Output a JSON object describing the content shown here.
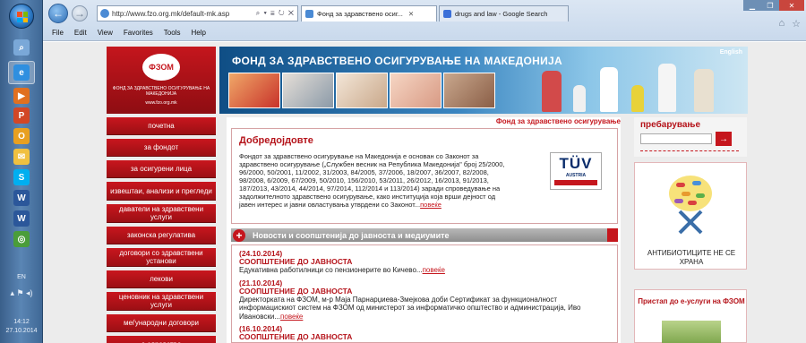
{
  "taskbar": {
    "apps": [
      {
        "name": "search-icon",
        "color": "#7aa8d8",
        "glyph": "⌕",
        "active": false
      },
      {
        "name": "internet-explorer-icon",
        "color": "#2f8fe0",
        "glyph": "e",
        "active": true
      },
      {
        "name": "media-player-icon",
        "color": "#e07020",
        "glyph": "▶",
        "active": false
      },
      {
        "name": "powerpoint-icon",
        "color": "#d24726",
        "glyph": "P",
        "active": false
      },
      {
        "name": "outlook-icon",
        "color": "#e8a020",
        "glyph": "O",
        "active": false
      },
      {
        "name": "mail-icon",
        "color": "#f0c040",
        "glyph": "✉",
        "active": false
      },
      {
        "name": "skype-icon",
        "color": "#00aff0",
        "glyph": "S",
        "active": false
      },
      {
        "name": "word-icon",
        "color": "#2b579a",
        "glyph": "W",
        "active": false
      },
      {
        "name": "word-icon-2",
        "color": "#2b579a",
        "glyph": "W",
        "active": false
      },
      {
        "name": "chrome-icon",
        "color": "#4a9d3a",
        "glyph": "◎",
        "active": false
      }
    ],
    "language": "EN",
    "time": "14:12",
    "date": "27.10.2014"
  },
  "browser": {
    "url": "http://www.fzo.org.mk/default-mk.asp",
    "address_actions": "⌕ ▾ ≣ ↻ ✕",
    "tabs": [
      {
        "label": "Фонд за здравствено осиг...",
        "active": true,
        "color": "#4a8ad4"
      },
      {
        "label": "drugs and law - Google Search",
        "active": false,
        "color": "#3a6fd8"
      }
    ],
    "menu": [
      "File",
      "Edit",
      "View",
      "Favorites",
      "Tools",
      "Help"
    ]
  },
  "site": {
    "logo_text": "ФЗОМ",
    "logo_sub": "ФОНД ЗА ЗДРАВСТВЕНО ОСИГУРУВАЊЕ НА МАКЕДОНИЈА",
    "logo_url": "www.fzo.org.mk",
    "banner_title": "ФОНД ЗА ЗДРАВСТВЕНО ОСИГУРУВАЊЕ НА МАКЕДОНИЈА",
    "english_link": "English",
    "nav": [
      "почетна",
      "за фондот",
      "за осигурени лица",
      "извештаи, анализи и прегледи",
      "даватели на здравствени услуги",
      "законска регулатива",
      "договори со здравствени установи",
      "лекови",
      "ценовник на здравствени услуги",
      "меѓународни договори",
      "е-здравство"
    ],
    "marquee": "Фонд за здравствено осигурување",
    "welcome": {
      "title": "Добредојдовте",
      "text": "Фондот за здравствено осигурување на Македонија е основан со Законот за здравствено осигурување („Службен весник на Република Македонија\" број 25/2000, 96/2000, 50/2001, 11/2002, 31/2003, 84/2005, 37/2006, 18/2007, 36/2007, 82/2008, 98/2008, 6/2009, 67/2009, 50/2010, 156/2010, 53/2011, 26/2012, 16/2013, 91/2013, 187/2013, 43/2014, 44/2014, 97/2014, 112/2014 и 113/2014) заради спроведување на задолжителното здравствено осигурување, како институција која врши дејност од јавен интерес и јавни овластувања утврдени со Законот...",
      "more": "повеќе"
    },
    "tuv": {
      "big": "TÜV",
      "sub": "AUSTRIA"
    },
    "news_title": "Новости и соопштенија до јавноста и медиумите",
    "news": [
      {
        "date": "(24.10.2014)",
        "category": "СООПШТЕНИЕ ДО ЈАВНОСТА",
        "text": "Едукативна работилници со пензионерите во Кичево...",
        "more": "повеќе"
      },
      {
        "date": "(21.10.2014)",
        "category": "СООПШТЕНИЕ ДО ЈАВНОСТА",
        "text": "Директорката на ФЗОМ, м-р Маја Парнарџиева-Змејкова доби Сертификат за функционалност информацискиот систем на ФЗОМ од министерот за информатичко општество и администрација, Иво Ивановски...",
        "more": "повеќе"
      },
      {
        "date": "(16.10.2014)",
        "category": "СООПШТЕНИЕ ДО ЈАВНОСТА",
        "text": "",
        "more": ""
      }
    ],
    "search_label": "пребарување",
    "search_value": "",
    "search_go": "→",
    "antibiotic_text": "АНТИБИОТИЦИТЕ НЕ СЕ ХРАНА",
    "eservice_text": "Пристап до е-услуги на ФЗОМ"
  }
}
